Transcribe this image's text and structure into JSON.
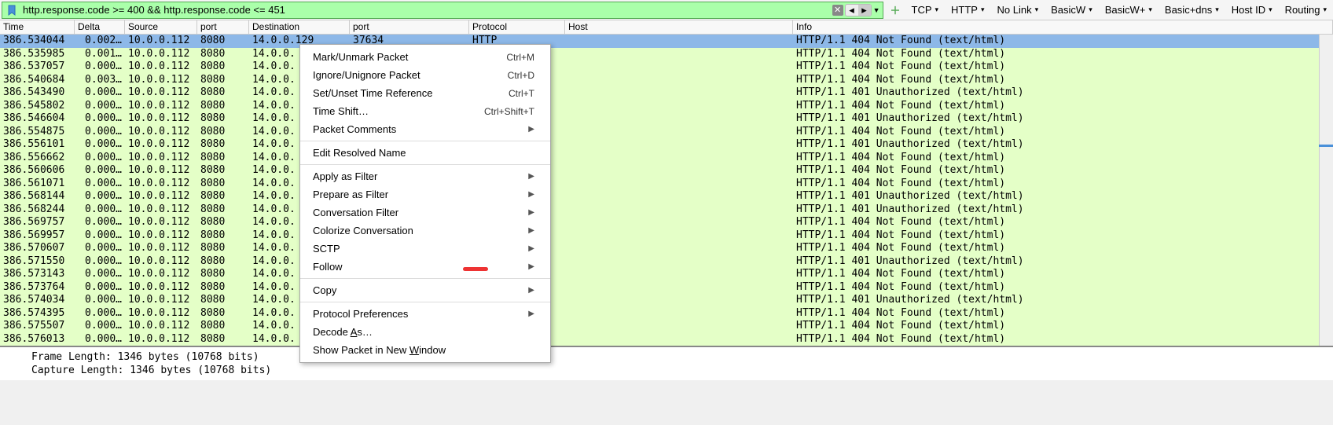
{
  "toolbar": {
    "filter": "http.response.code >= 400 && http.response.code <= 451",
    "items": [
      "TCP",
      "HTTP",
      "No Link",
      "BasicW",
      "BasicW+",
      "Basic+dns",
      "Host ID",
      "Routing"
    ]
  },
  "columns": [
    "Time",
    "Delta",
    "Source",
    "port",
    "Destination",
    "port",
    "Protocol",
    "Host",
    "Info"
  ],
  "packets": [
    {
      "time": "386.534044",
      "delta": "0.002…",
      "src": "10.0.0.112",
      "sp": "8080",
      "dst": "14.0.0.129",
      "dp": "37634",
      "proto": "HTTP",
      "info": "HTTP/1.1 404 Not Found  (text/html)",
      "sel": true,
      "trunc": false
    },
    {
      "time": "386.535985",
      "delta": "0.001…",
      "src": "10.0.0.112",
      "sp": "8080",
      "dst": "14.0.0.",
      "dp": "",
      "proto": "",
      "info": "HTTP/1.1 404 Not Found  (text/html)",
      "trunc": true
    },
    {
      "time": "386.537057",
      "delta": "0.000…",
      "src": "10.0.0.112",
      "sp": "8080",
      "dst": "14.0.0.",
      "dp": "",
      "proto": "",
      "info": "HTTP/1.1 404 Not Found  (text/html)",
      "trunc": true
    },
    {
      "time": "386.540684",
      "delta": "0.003…",
      "src": "10.0.0.112",
      "sp": "8080",
      "dst": "14.0.0.",
      "dp": "",
      "proto": "",
      "info": "HTTP/1.1 404 Not Found  (text/html)",
      "trunc": true
    },
    {
      "time": "386.543490",
      "delta": "0.000…",
      "src": "10.0.0.112",
      "sp": "8080",
      "dst": "14.0.0.",
      "dp": "",
      "proto": "",
      "info": "HTTP/1.1 401 Unauthorized  (text/html)",
      "trunc": true
    },
    {
      "time": "386.545802",
      "delta": "0.000…",
      "src": "10.0.0.112",
      "sp": "8080",
      "dst": "14.0.0.",
      "dp": "",
      "proto": "",
      "info": "HTTP/1.1 404 Not Found  (text/html)",
      "trunc": true
    },
    {
      "time": "386.546604",
      "delta": "0.000…",
      "src": "10.0.0.112",
      "sp": "8080",
      "dst": "14.0.0.",
      "dp": "",
      "proto": "",
      "info": "HTTP/1.1 401 Unauthorized  (text/html)",
      "trunc": true
    },
    {
      "time": "386.554875",
      "delta": "0.000…",
      "src": "10.0.0.112",
      "sp": "8080",
      "dst": "14.0.0.",
      "dp": "",
      "proto": "",
      "info": "HTTP/1.1 404 Not Found  (text/html)",
      "trunc": true
    },
    {
      "time": "386.556101",
      "delta": "0.000…",
      "src": "10.0.0.112",
      "sp": "8080",
      "dst": "14.0.0.",
      "dp": "",
      "proto": "",
      "info": "HTTP/1.1 401 Unauthorized  (text/html)",
      "trunc": true
    },
    {
      "time": "386.556662",
      "delta": "0.000…",
      "src": "10.0.0.112",
      "sp": "8080",
      "dst": "14.0.0.",
      "dp": "",
      "proto": "",
      "info": "HTTP/1.1 404 Not Found  (text/html)",
      "trunc": true
    },
    {
      "time": "386.560606",
      "delta": "0.000…",
      "src": "10.0.0.112",
      "sp": "8080",
      "dst": "14.0.0.",
      "dp": "",
      "proto": "",
      "info": "HTTP/1.1 404 Not Found  (text/html)",
      "trunc": true
    },
    {
      "time": "386.561071",
      "delta": "0.000…",
      "src": "10.0.0.112",
      "sp": "8080",
      "dst": "14.0.0.",
      "dp": "",
      "proto": "",
      "info": "HTTP/1.1 404 Not Found  (text/html)",
      "trunc": true
    },
    {
      "time": "386.568144",
      "delta": "0.000…",
      "src": "10.0.0.112",
      "sp": "8080",
      "dst": "14.0.0.",
      "dp": "",
      "proto": "",
      "info": "HTTP/1.1 401 Unauthorized  (text/html)",
      "trunc": true
    },
    {
      "time": "386.568244",
      "delta": "0.000…",
      "src": "10.0.0.112",
      "sp": "8080",
      "dst": "14.0.0.",
      "dp": "",
      "proto": "",
      "info": "HTTP/1.1 401 Unauthorized  (text/html)",
      "trunc": true
    },
    {
      "time": "386.569757",
      "delta": "0.000…",
      "src": "10.0.0.112",
      "sp": "8080",
      "dst": "14.0.0.",
      "dp": "",
      "proto": "",
      "info": "HTTP/1.1 404 Not Found  (text/html)",
      "trunc": true
    },
    {
      "time": "386.569957",
      "delta": "0.000…",
      "src": "10.0.0.112",
      "sp": "8080",
      "dst": "14.0.0.",
      "dp": "",
      "proto": "",
      "info": "HTTP/1.1 404 Not Found  (text/html)",
      "trunc": true
    },
    {
      "time": "386.570607",
      "delta": "0.000…",
      "src": "10.0.0.112",
      "sp": "8080",
      "dst": "14.0.0.",
      "dp": "",
      "proto": "",
      "info": "HTTP/1.1 404 Not Found  (text/html)",
      "trunc": true
    },
    {
      "time": "386.571550",
      "delta": "0.000…",
      "src": "10.0.0.112",
      "sp": "8080",
      "dst": "14.0.0.",
      "dp": "",
      "proto": "",
      "info": "HTTP/1.1 401 Unauthorized  (text/html)",
      "trunc": true
    },
    {
      "time": "386.573143",
      "delta": "0.000…",
      "src": "10.0.0.112",
      "sp": "8080",
      "dst": "14.0.0.",
      "dp": "",
      "proto": "",
      "info": "HTTP/1.1 404 Not Found  (text/html)",
      "trunc": true
    },
    {
      "time": "386.573764",
      "delta": "0.000…",
      "src": "10.0.0.112",
      "sp": "8080",
      "dst": "14.0.0.",
      "dp": "",
      "proto": "",
      "info": "HTTP/1.1 404 Not Found  (text/html)",
      "trunc": true
    },
    {
      "time": "386.574034",
      "delta": "0.000…",
      "src": "10.0.0.112",
      "sp": "8080",
      "dst": "14.0.0.",
      "dp": "",
      "proto": "",
      "info": "HTTP/1.1 401 Unauthorized  (text/html)",
      "trunc": true
    },
    {
      "time": "386.574395",
      "delta": "0.000…",
      "src": "10.0.0.112",
      "sp": "8080",
      "dst": "14.0.0.",
      "dp": "",
      "proto": "",
      "info": "HTTP/1.1 404 Not Found  (text/html)",
      "trunc": true
    },
    {
      "time": "386.575507",
      "delta": "0.000…",
      "src": "10.0.0.112",
      "sp": "8080",
      "dst": "14.0.0.",
      "dp": "",
      "proto": "",
      "info": "HTTP/1.1 404 Not Found  (text/html)",
      "trunc": true
    },
    {
      "time": "386.576013",
      "delta": "0.000…",
      "src": "10.0.0.112",
      "sp": "8080",
      "dst": "14.0.0.",
      "dp": "",
      "proto": "",
      "info": "HTTP/1.1 404 Not Found  (text/html)",
      "trunc": true
    }
  ],
  "context_menu": [
    {
      "label": "Mark/Unmark Packet",
      "shortcut": "Ctrl+M"
    },
    {
      "label": "Ignore/Unignore Packet",
      "shortcut": "Ctrl+D"
    },
    {
      "label": "Set/Unset Time Reference",
      "shortcut": "Ctrl+T"
    },
    {
      "label": "Time Shift…",
      "shortcut": "Ctrl+Shift+T"
    },
    {
      "label": "Packet Comments",
      "sub": true
    },
    {
      "sep": true
    },
    {
      "label": "Edit Resolved Name"
    },
    {
      "sep": true
    },
    {
      "label": "Apply as Filter",
      "sub": true
    },
    {
      "label": "Prepare as Filter",
      "sub": true
    },
    {
      "label": "Conversation Filter",
      "sub": true
    },
    {
      "label": "Colorize Conversation",
      "sub": true
    },
    {
      "label": "SCTP",
      "sub": true
    },
    {
      "label": "Follow",
      "sub": true
    },
    {
      "sep": true
    },
    {
      "label": "Copy",
      "sub": true
    },
    {
      "sep": true
    },
    {
      "label": "Protocol Preferences",
      "sub": true
    },
    {
      "label": "Decode As…",
      "u": "A"
    },
    {
      "label": "Show Packet in New Window",
      "u": "W"
    }
  ],
  "details": {
    "line1": "Frame Length: 1346 bytes (10768 bits)",
    "line2": "Capture Length: 1346 bytes (10768 bits)"
  }
}
